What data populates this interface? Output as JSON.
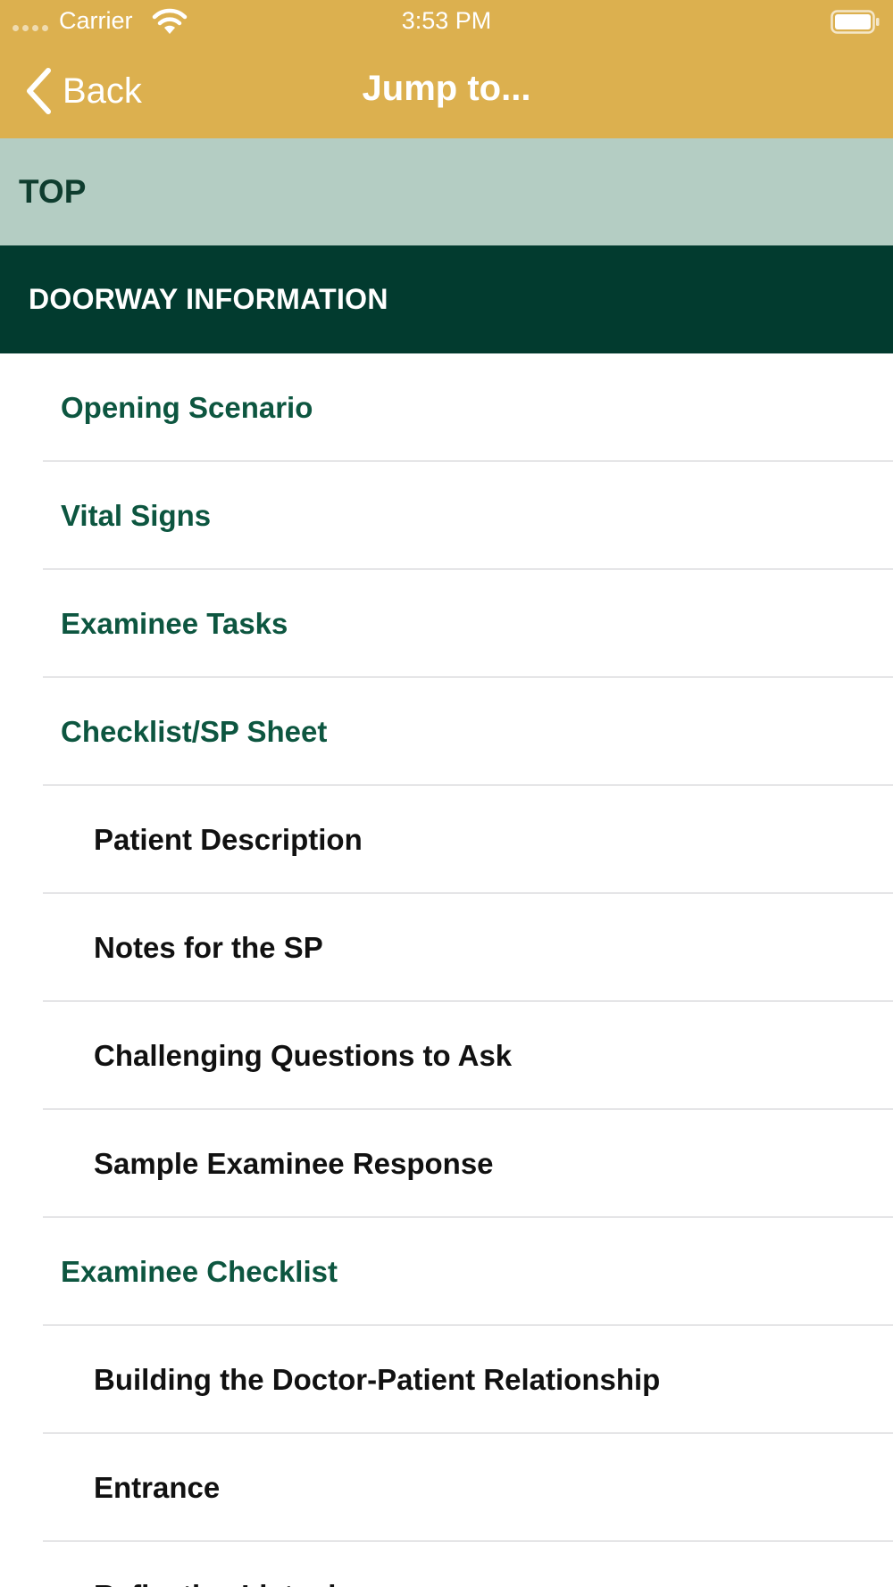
{
  "status_bar": {
    "carrier": "Carrier",
    "time": "3:53 PM"
  },
  "nav": {
    "back_label": "Back",
    "title": "Jump to...",
    "colors": {
      "bar": "#dcb04f",
      "text": "#ffffff"
    }
  },
  "top_row": {
    "label": "TOP",
    "color": "#b4cdc3"
  },
  "section_header": {
    "label": "DOORWAY INFORMATION",
    "color": "#023b2f"
  },
  "list": {
    "colors": {
      "level1": "#0d5640",
      "level2": "#111111"
    },
    "items": [
      {
        "label": "Opening Scenario",
        "level": 1
      },
      {
        "label": "Vital Signs",
        "level": 1
      },
      {
        "label": "Examinee Tasks",
        "level": 1
      },
      {
        "label": "Checklist/SP Sheet",
        "level": 1
      },
      {
        "label": "Patient Description",
        "level": 2
      },
      {
        "label": "Notes for the SP",
        "level": 2
      },
      {
        "label": "Challenging Questions to Ask",
        "level": 2
      },
      {
        "label": "Sample Examinee Response",
        "level": 2
      },
      {
        "label": "Examinee Checklist",
        "level": 1
      },
      {
        "label": "Building the Doctor-Patient Relationship",
        "level": 2
      },
      {
        "label": "Entrance",
        "level": 2
      },
      {
        "label": "Reflective Listening",
        "level": 2
      }
    ]
  }
}
